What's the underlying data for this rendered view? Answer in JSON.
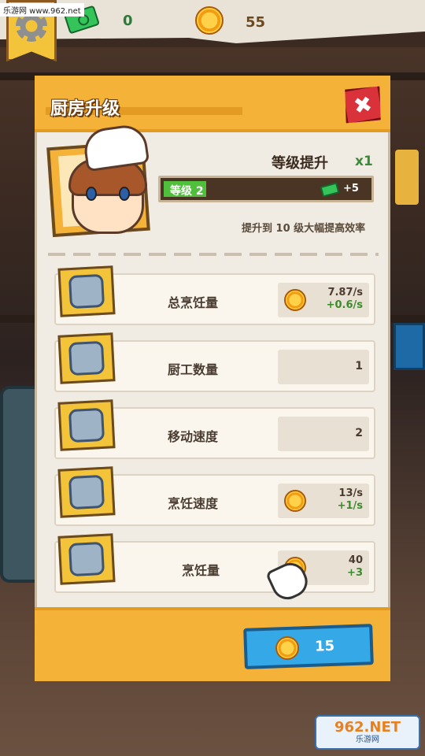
{
  "watermark": {
    "top": "乐游网 www.962.net",
    "logo_big": "962.NET",
    "logo_small": "乐游网"
  },
  "topbar": {
    "cash": "0",
    "coins": "55",
    "accent": "#f3c43a"
  },
  "dialog": {
    "title": "厨房升级",
    "close_icon": "✖",
    "level_up_label": "等级提升",
    "level_multiplier": "x1",
    "level_text": "等级 2",
    "level_bonus": "+5",
    "level_progress": 0.2,
    "hint": "提升到 10 级大幅提高效率",
    "rows": [
      {
        "label": "总烹饪量",
        "icon": "chef-icon",
        "value": "7.87/s",
        "delta": "+0.6/s",
        "has_coin": true
      },
      {
        "label": "厨工数量",
        "icon": "chef-icon",
        "value": "1",
        "delta": "",
        "has_coin": false
      },
      {
        "label": "移动速度",
        "icon": "boots-icon",
        "value": "2",
        "delta": "",
        "has_coin": false
      },
      {
        "label": "烹饪速度",
        "icon": "pot-icon",
        "value": "13/s",
        "delta": "+1/s",
        "has_coin": true
      },
      {
        "label": "烹饪量",
        "icon": "pot-icon",
        "value": "40",
        "delta": "+3",
        "has_coin": true
      }
    ],
    "upgrade_button": {
      "label": "15",
      "icon": "coin-icon"
    }
  }
}
